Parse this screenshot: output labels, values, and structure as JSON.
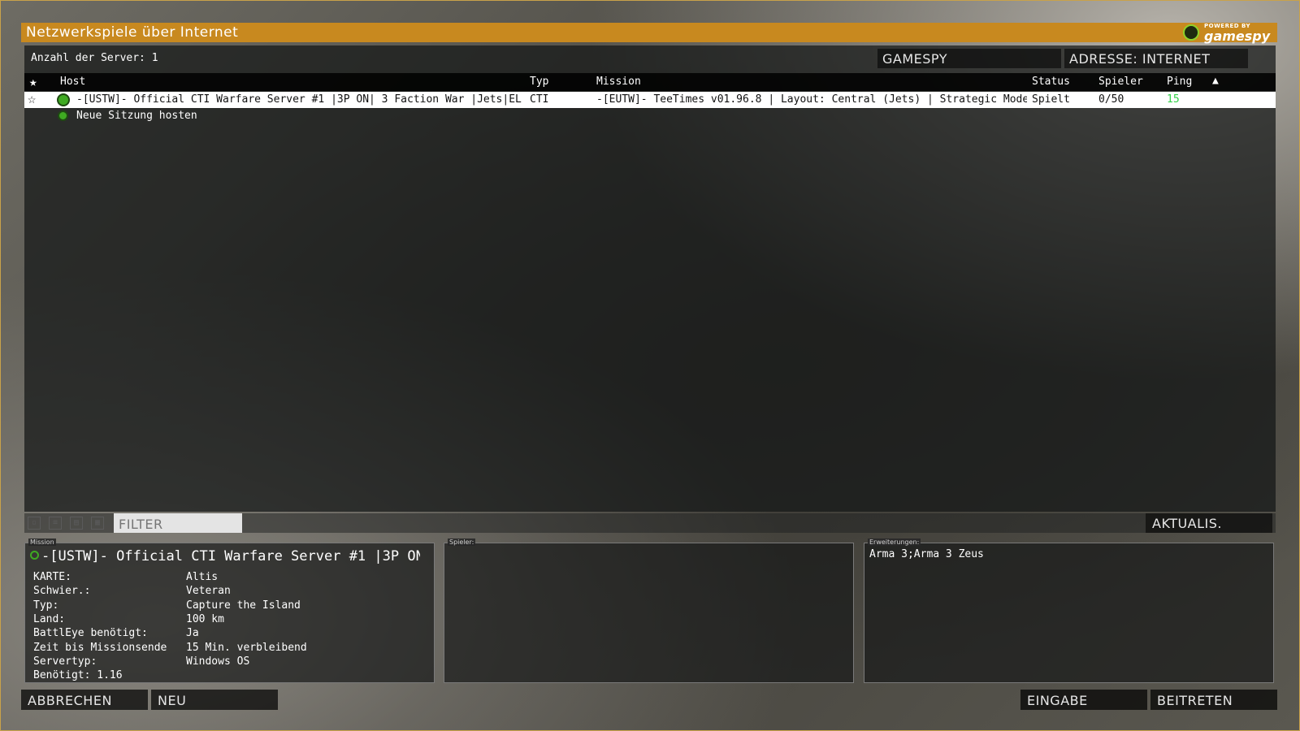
{
  "window": {
    "title": "Netzwerkspiele über Internet",
    "logo_powered": "POWERED BY",
    "logo_name": "gamespy"
  },
  "server_list": {
    "count_label": "Anzahl der Server: 1",
    "source_button": "GAMESPY",
    "address_button": "ADRESSE: INTERNET",
    "columns": {
      "favorite": "★",
      "host": "Host",
      "type": "Typ",
      "mission": "Mission",
      "status": "Status",
      "players": "Spieler",
      "ping": "Ping",
      "sort_indicator": "▲"
    },
    "rows": [
      {
        "favorite": "☆",
        "host": "-[USTW]- Official CTI Warfare Server #1 |3P ON| 3 Faction War |Jets|EL",
        "type": "CTI",
        "mission": "-[EUTW]- TeeTimes v01.96.8 | Layout: Central (Jets) | Strategic Mode",
        "status": "Spielt",
        "players": "0/50",
        "ping": "15"
      }
    ],
    "host_session_label": "Neue Sitzung hosten"
  },
  "toolbar": {
    "icons": [
      "icon-a",
      "icon-b",
      "icon-c",
      "icon-d"
    ],
    "filter_placeholder": "FILTER",
    "refresh_label": "AKTUALIS."
  },
  "mission_panel": {
    "legend": "Mission",
    "title": "-[USTW]- Official CTI Warfare Server #1 |3P ON",
    "details": [
      {
        "label": "KARTE:",
        "value": "Altis"
      },
      {
        "label": "Schwier.:",
        "value": "Veteran"
      },
      {
        "label": "Typ:",
        "value": "Capture the Island"
      },
      {
        "label": "Land:",
        "value": "100 km"
      },
      {
        "label": "BattlEye benötigt:",
        "value": "Ja"
      },
      {
        "label": "Zeit bis Missionsende",
        "value": "15 Min. verbleibend"
      },
      {
        "label": "Servertyp:",
        "value": "Windows OS"
      },
      {
        "label": "Benötigt: 1.16",
        "value": ""
      }
    ]
  },
  "players_panel": {
    "legend": "Spieler:"
  },
  "extensions_panel": {
    "legend": "Erweiterungen:",
    "value": "Arma 3;Arma 3 Zeus"
  },
  "bottom_buttons": {
    "cancel": "ABBRECHEN",
    "new": "NEU",
    "input": "EINGABE",
    "join": "BEITRETEN"
  },
  "colors": {
    "title_bar": "#c8891f",
    "ping_good": "#34d24a",
    "status_online": "#3faa22"
  }
}
